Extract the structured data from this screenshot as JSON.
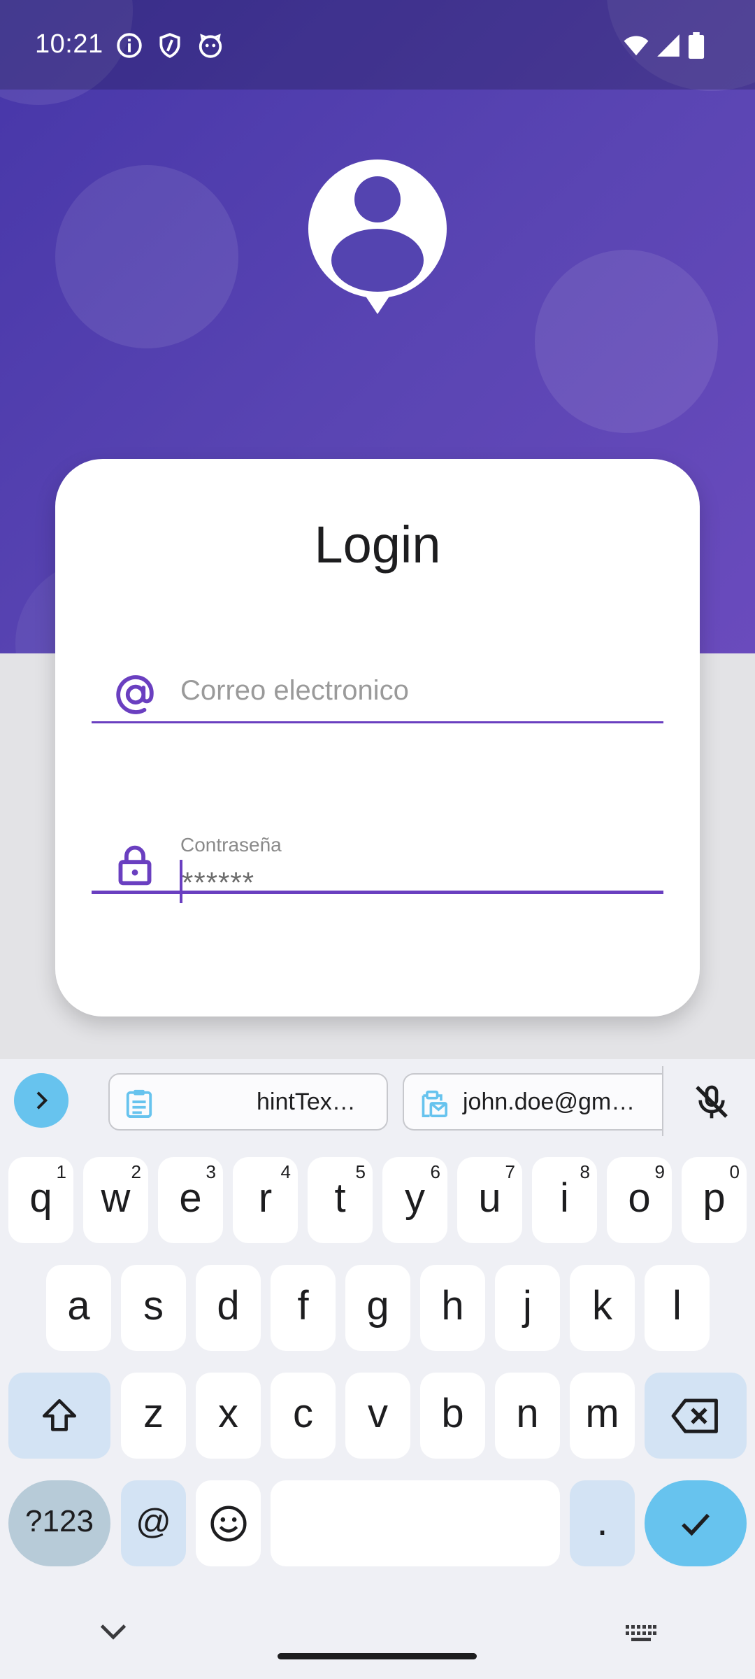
{
  "status_bar": {
    "time": "10:21",
    "icons": [
      "info-icon",
      "shield-icon",
      "cat-face-icon",
      "wifi-icon",
      "signal-icon",
      "battery-icon"
    ]
  },
  "colors": {
    "brand_purple": "#5a45b3",
    "accent_purple": "#6a3fc0",
    "keyboard_blue": "#67c3ee",
    "modifier_key": "#d3e3f4"
  },
  "login": {
    "title": "Login",
    "email": {
      "placeholder": "Correo electronico",
      "icon": "at-sign-icon",
      "value": ""
    },
    "password": {
      "label": "Contraseña",
      "value": "******",
      "icon": "lock-icon"
    }
  },
  "keyboard": {
    "suggestions": [
      {
        "icon": "clipboard-icon",
        "text": "hintTex…"
      },
      {
        "icon": "clipboard-mail-icon",
        "text": "john.doe@gm…"
      }
    ],
    "row1": [
      {
        "key": "q",
        "hint": "1"
      },
      {
        "key": "w",
        "hint": "2"
      },
      {
        "key": "e",
        "hint": "3"
      },
      {
        "key": "r",
        "hint": "4"
      },
      {
        "key": "t",
        "hint": "5"
      },
      {
        "key": "y",
        "hint": "6"
      },
      {
        "key": "u",
        "hint": "7"
      },
      {
        "key": "i",
        "hint": "8"
      },
      {
        "key": "o",
        "hint": "9"
      },
      {
        "key": "p",
        "hint": "0"
      }
    ],
    "row2": [
      "a",
      "s",
      "d",
      "f",
      "g",
      "h",
      "j",
      "k",
      "l"
    ],
    "row3": [
      "z",
      "x",
      "c",
      "v",
      "b",
      "n",
      "m"
    ],
    "row4": {
      "symbols": "?123",
      "at": "@",
      "period": "."
    }
  }
}
